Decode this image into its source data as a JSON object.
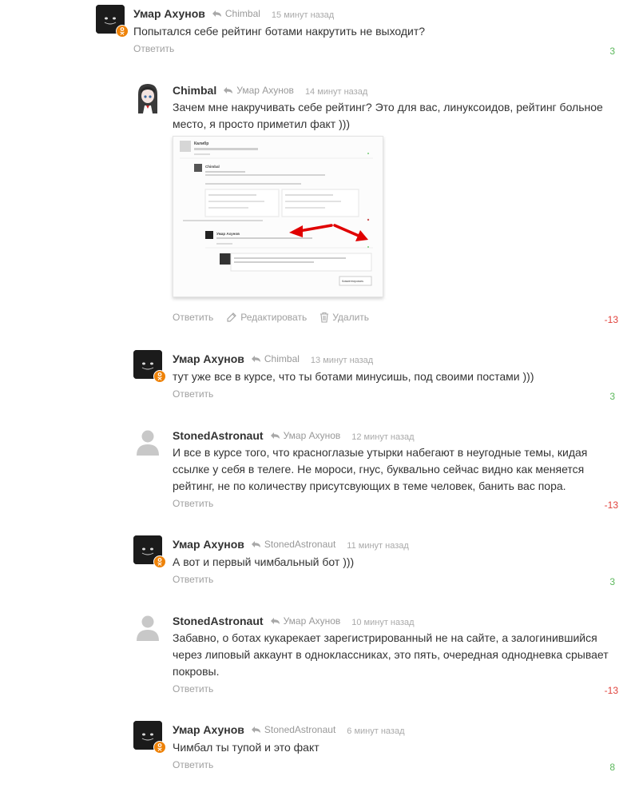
{
  "colors": {
    "author": "#333333",
    "meta": "#999999",
    "positive": "#5cb85c",
    "negative": "#e0413b",
    "ok_badge": "#ee8208",
    "arrow": "#e00000"
  },
  "comments": [
    {
      "author": "Умар Ахунов",
      "reply_to": "Chimbal",
      "time": "15 минут назад",
      "text": "Попытался себе рейтинг ботами накрутить не выходит?",
      "reply_label": "Ответить",
      "rating": "3",
      "avatar": "cat-face-dark"
    },
    {
      "author": "Chimbal",
      "reply_to": "Умар Ахунов",
      "time": "14 минут назад",
      "text_lines": [
        "Зачем мне накручивать себе рейтинг? Это для вас, линуксоидов, рейтинг больное",
        "место, я просто приметил факт )))"
      ],
      "reply_label": "Ответить",
      "edit_label": "Редактировать",
      "delete_label": "Удалить",
      "rating": "-13",
      "avatar": "anime-girl"
    },
    {
      "author": "Умар Ахунов",
      "reply_to": "Chimbal",
      "time": "13 минут назад",
      "text": "тут уже все в курсе, что ты ботами минусишь, под своими постами )))",
      "reply_label": "Ответить",
      "rating": "3",
      "avatar": "cat-face-dark"
    },
    {
      "author": "StonedAstronaut",
      "reply_to": "Умар Ахунов",
      "time": "12 минут назад",
      "text_lines": [
        "И все в курсе того, что красноглазые утырки набегают в неугодные темы, кидая",
        "ссылке у себя в телеге. Не мороси, гнус, буквально сейчас видно как меняется",
        "рейтинг, не по количеству присутсвующих в теме человек, банить вас пора."
      ],
      "reply_label": "Ответить",
      "rating": "-13",
      "avatar": "default-user"
    },
    {
      "author": "Умар Ахунов",
      "reply_to": "StonedAstronaut",
      "time": "11 минут назад",
      "text": "А вот и первый чимбальный бот )))",
      "reply_label": "Ответить",
      "rating": "3",
      "avatar": "cat-face-dark"
    },
    {
      "author": "StonedAstronaut",
      "reply_to": "Умар Ахунов",
      "time": "10 минут назад",
      "text_lines": [
        "Забавно, о ботах кукарекает зарегистрированный не на сайте, а залогинившийся",
        "через липовый аккаунт в одноклассниках, это пять, очередная однодневка срывает",
        "покровы."
      ],
      "reply_label": "Ответить",
      "rating": "-13",
      "avatar": "default-user"
    },
    {
      "author": "Умар Ахунов",
      "reply_to": "StonedAstronaut",
      "time": "6 минут назад",
      "text": "Чимбал ты тупой и это факт",
      "reply_label": "Ответить",
      "rating": "8",
      "avatar": "cat-face-dark"
    }
  ],
  "screenshot": {
    "alt_author_1": "Калибр",
    "alt_author_2": "Chimbal",
    "alt_author_3": "Умар Ахунов",
    "button": "Комментировать"
  }
}
